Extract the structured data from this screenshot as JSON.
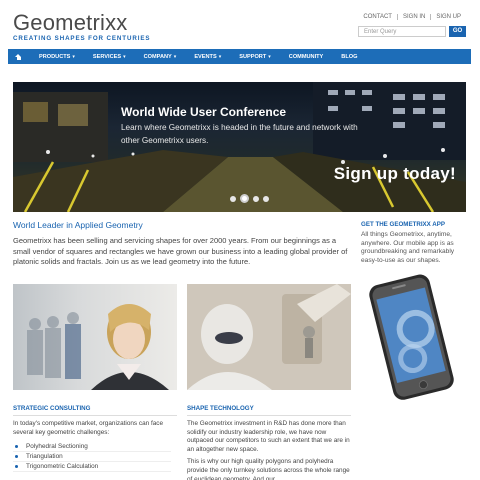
{
  "brand": {
    "name": "Geometrixx",
    "tagline": "CREATING SHAPES FOR CENTURIES"
  },
  "toplinks": [
    "CONTACT",
    "SIGN IN",
    "SIGN UP"
  ],
  "search": {
    "placeholder": "Enter Query",
    "button": "GO"
  },
  "nav": {
    "home_icon": "home-icon",
    "items": [
      {
        "label": "PRODUCTS",
        "dropdown": true
      },
      {
        "label": "SERVICES",
        "dropdown": true
      },
      {
        "label": "COMPANY",
        "dropdown": true
      },
      {
        "label": "EVENTS",
        "dropdown": true
      },
      {
        "label": "SUPPORT",
        "dropdown": true
      },
      {
        "label": "COMMUNITY",
        "dropdown": false
      },
      {
        "label": "BLOG",
        "dropdown": false
      }
    ],
    "background": "#1d6db8"
  },
  "hero": {
    "title": "World Wide User Conference",
    "subtitle": "Learn where Geometrixx is headed in the future and network with other Geometrixx users.",
    "cta": "Sign up today!",
    "slides": 4,
    "active_slide": 2
  },
  "main": {
    "title": "World Leader in Applied Geometry",
    "body": "Geometrixx has been selling and servicing shapes for over 2000 years. From our beginnings as a small vendor of squares and rectangles we have grown our business into a leading global provider of platonic solids and fractals. Join us as we lead geometry into the future."
  },
  "sidebar": {
    "app_title": "GET THE GEOMETRIXX APP",
    "app_body": "All things Geometrixx, anytime, anywhere. Our mobile app is as groundbreaking and remarkably easy-to-use as our shapes."
  },
  "features": {
    "consulting": {
      "title": "STRATEGIC CONSULTING",
      "intro": "In today's competitive market, organizations can face several key geometric challenges:",
      "items": [
        "Polyhedral Sectioning",
        "Triangulation",
        "Trigonometric Calculation"
      ]
    },
    "technology": {
      "title": "SHAPE TECHNOLOGY",
      "p1": "The Geometrixx investment in R&D has done more than solidify our industry leadership role, we have now outpaced our competitors to such an extent that we are in an altogether new space.",
      "p2": "This is why our high quality polygons and polyhedra provide the only turnkey solutions across the whole range of euclidean geometry. And our"
    }
  },
  "colors": {
    "accent": "#1a64b0"
  }
}
